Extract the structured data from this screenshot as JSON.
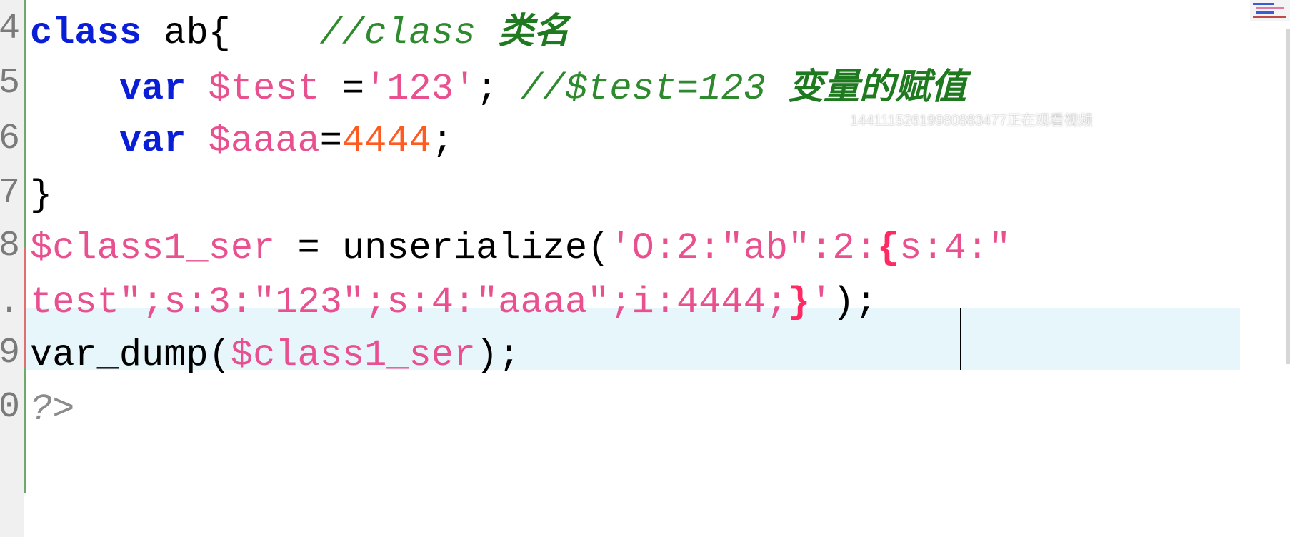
{
  "editor": {
    "lines": [
      {
        "number": "4",
        "tokens": [
          {
            "type": "kw",
            "text": "class"
          },
          {
            "type": "plain",
            "text": " ab{    "
          },
          {
            "type": "cmt",
            "text": "//class "
          },
          {
            "type": "cn",
            "text": "类名"
          }
        ]
      },
      {
        "number": "5",
        "tokens": [
          {
            "type": "plain",
            "text": "    "
          },
          {
            "type": "kw",
            "text": "var"
          },
          {
            "type": "plain",
            "text": " "
          },
          {
            "type": "var",
            "text": "$test"
          },
          {
            "type": "plain",
            "text": " ="
          },
          {
            "type": "str",
            "text": "'123'"
          },
          {
            "type": "plain",
            "text": "; "
          },
          {
            "type": "cmt",
            "text": "//$test=123 "
          },
          {
            "type": "cn",
            "text": "变量的赋值"
          }
        ]
      },
      {
        "number": "6",
        "tokens": [
          {
            "type": "plain",
            "text": "    "
          },
          {
            "type": "kw",
            "text": "var"
          },
          {
            "type": "plain",
            "text": " "
          },
          {
            "type": "var",
            "text": "$aaaa"
          },
          {
            "type": "plain",
            "text": "="
          },
          {
            "type": "num",
            "text": "4444"
          },
          {
            "type": "plain",
            "text": ";"
          }
        ]
      },
      {
        "number": "7",
        "tokens": [
          {
            "type": "plain",
            "text": "}"
          }
        ]
      },
      {
        "number": "8",
        "tokens": [
          {
            "type": "var",
            "text": "$class1_ser"
          },
          {
            "type": "plain",
            "text": " = unserialize("
          },
          {
            "type": "str",
            "text": "'O:2:\"ab\":2:"
          },
          {
            "type": "brace-hl",
            "text": "{"
          },
          {
            "type": "str",
            "text": "s:4:\""
          }
        ]
      },
      {
        "number": ".",
        "tokens": [
          {
            "type": "str",
            "text": "test\";s:3:\"123\";s:4:\"aaaa\";i:4444;"
          },
          {
            "type": "brace-hl",
            "text": "}"
          },
          {
            "type": "str",
            "text": "'"
          },
          {
            "type": "plain",
            "text": ");"
          }
        ]
      },
      {
        "number": "9",
        "tokens": [
          {
            "type": "plain",
            "text": "var_dump("
          },
          {
            "type": "var",
            "text": "$class1_ser"
          },
          {
            "type": "plain",
            "text": ");"
          }
        ]
      },
      {
        "number": "0",
        "tokens": [
          {
            "type": "php-close",
            "text": "?>"
          }
        ]
      }
    ]
  },
  "overlay": {
    "watermark": "14411152619980883477正在观看视频"
  },
  "colors": {
    "keyword": "#0a1ed8",
    "variable": "#e8508f",
    "number": "#ff5a1f",
    "comment": "#2f8a2f",
    "chinese_annotation": "#1f7a1f",
    "current_line_bg": "#e6f6fb",
    "brace_match": "#ff2a64"
  }
}
